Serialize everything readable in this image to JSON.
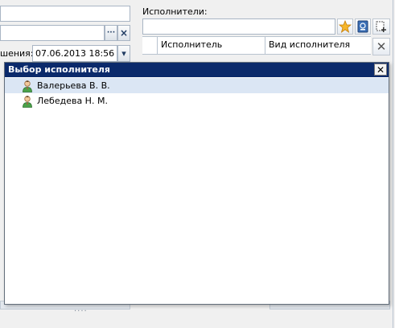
{
  "background_form": {
    "performers_label": "Исполнители:",
    "date_label": "шения:",
    "date_value": "07.06.2013 18:56",
    "ellipsis_label": "···",
    "clear_label": "×",
    "dropdown_glyph": "▾",
    "grid": {
      "columns": [
        "Исполнитель",
        "Вид исполнителя"
      ]
    },
    "toolbar": {
      "favorite_icon": "star-icon",
      "address_book_icon": "address-book-icon",
      "add_icon": "add-icon",
      "remove_icon": "remove-icon",
      "remove_glyph": "✕"
    },
    "bottom_grip": "····"
  },
  "dialog": {
    "title": "Выбор исполнителя",
    "close_glyph": "✕",
    "items": [
      {
        "label": "Валерьева В. В.",
        "icon": "user-icon",
        "selected": true
      },
      {
        "label": "Лебедева Н. М.",
        "icon": "user-icon",
        "selected": false
      }
    ]
  },
  "colors": {
    "title_bar": "#0b2a6b",
    "selection": "#dbe6f4"
  }
}
